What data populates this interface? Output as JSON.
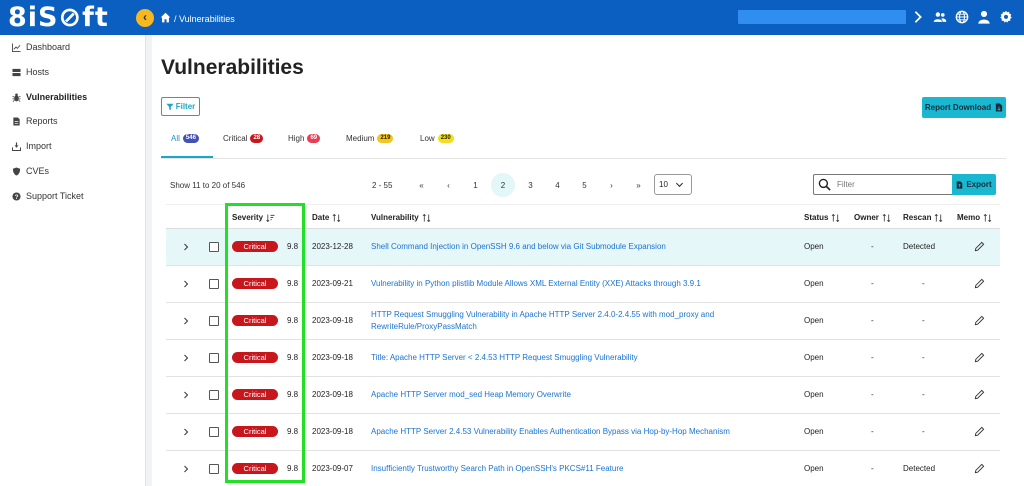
{
  "app": {
    "logo": "8iS⊘ft",
    "breadcrumb": "/ Vulnerabilities"
  },
  "sidebar": {
    "items": [
      {
        "label": "Dashboard",
        "icon": "chart-line-icon"
      },
      {
        "label": "Hosts",
        "icon": "server-icon"
      },
      {
        "label": "Vulnerabilities",
        "icon": "bug-icon",
        "active": true
      },
      {
        "label": "Reports",
        "icon": "file-icon"
      },
      {
        "label": "Import",
        "icon": "import-icon"
      },
      {
        "label": "CVEs",
        "icon": "shield-icon"
      },
      {
        "label": "Support Ticket",
        "icon": "question-icon"
      }
    ]
  },
  "page": {
    "title": "Vulnerabilities",
    "filter_label": "Filter",
    "report_download_label": "Report Download",
    "show_text": "Show 11 to 20 of 546",
    "export_label": "Export",
    "search_placeholder": "Filter",
    "per_page": "10"
  },
  "tabs": [
    {
      "label": "All",
      "count": "546",
      "active": true
    },
    {
      "label": "Critical",
      "count": "28"
    },
    {
      "label": "High",
      "count": "69"
    },
    {
      "label": "Medium",
      "count": "219"
    },
    {
      "label": "Low",
      "count": "230"
    }
  ],
  "pagination": {
    "range": "2 - 55",
    "first": "«",
    "prev": "‹",
    "pages": [
      "1",
      "2",
      "3",
      "4",
      "5"
    ],
    "current": "2",
    "next": "›",
    "last": "»"
  },
  "table": {
    "headers": {
      "severity": "Severity",
      "date": "Date",
      "vulnerability": "Vulnerability",
      "status": "Status",
      "owner": "Owner",
      "rescan": "Rescan",
      "memo": "Memo"
    },
    "rows": [
      {
        "severity": "Critical",
        "score": "9.8",
        "date": "2023-12-28",
        "vulnerability": "Shell Command Injection in OpenSSH 9.6 and below via Git Submodule Expansion",
        "status": "Open",
        "owner": "-",
        "rescan": "Detected"
      },
      {
        "severity": "Critical",
        "score": "9.8",
        "date": "2023-09-21",
        "vulnerability": "Vulnerability in Python plistlib Module Allows XML External Entity (XXE) Attacks through 3.9.1",
        "status": "Open",
        "owner": "-",
        "rescan": "-"
      },
      {
        "severity": "Critical",
        "score": "9.8",
        "date": "2023-09-18",
        "vulnerability": "HTTP Request Smuggling Vulnerability in Apache HTTP Server 2.4.0-2.4.55 with mod_proxy and",
        "vulnerability2": "RewriteRule/ProxyPassMatch",
        "status": "Open",
        "owner": "-",
        "rescan": "-"
      },
      {
        "severity": "Critical",
        "score": "9.8",
        "date": "2023-09-18",
        "vulnerability": "Title: Apache HTTP Server < 2.4.53 HTTP Request Smuggling Vulnerability",
        "status": "Open",
        "owner": "-",
        "rescan": "-"
      },
      {
        "severity": "Critical",
        "score": "9.8",
        "date": "2023-09-18",
        "vulnerability": "Apache HTTP Server mod_sed Heap Memory Overwrite",
        "status": "Open",
        "owner": "-",
        "rescan": "-"
      },
      {
        "severity": "Critical",
        "score": "9.8",
        "date": "2023-09-18",
        "vulnerability": "Apache HTTP Server 2.4.53 Vulnerability Enables Authentication Bypass via Hop-by-Hop Mechanism",
        "status": "Open",
        "owner": "-",
        "rescan": "-"
      },
      {
        "severity": "Critical",
        "score": "9.8",
        "date": "2023-09-07",
        "vulnerability": "Insufficiently Trustworthy Search Path in OpenSSH's PKCS#11 Feature",
        "status": "Open",
        "owner": "-",
        "rescan": "Detected"
      }
    ]
  },
  "colors": {
    "topbar": "#0a5fc0",
    "accent": "#1ab8d0",
    "critical": "#c8161d",
    "highlight_box": "#22e025"
  }
}
